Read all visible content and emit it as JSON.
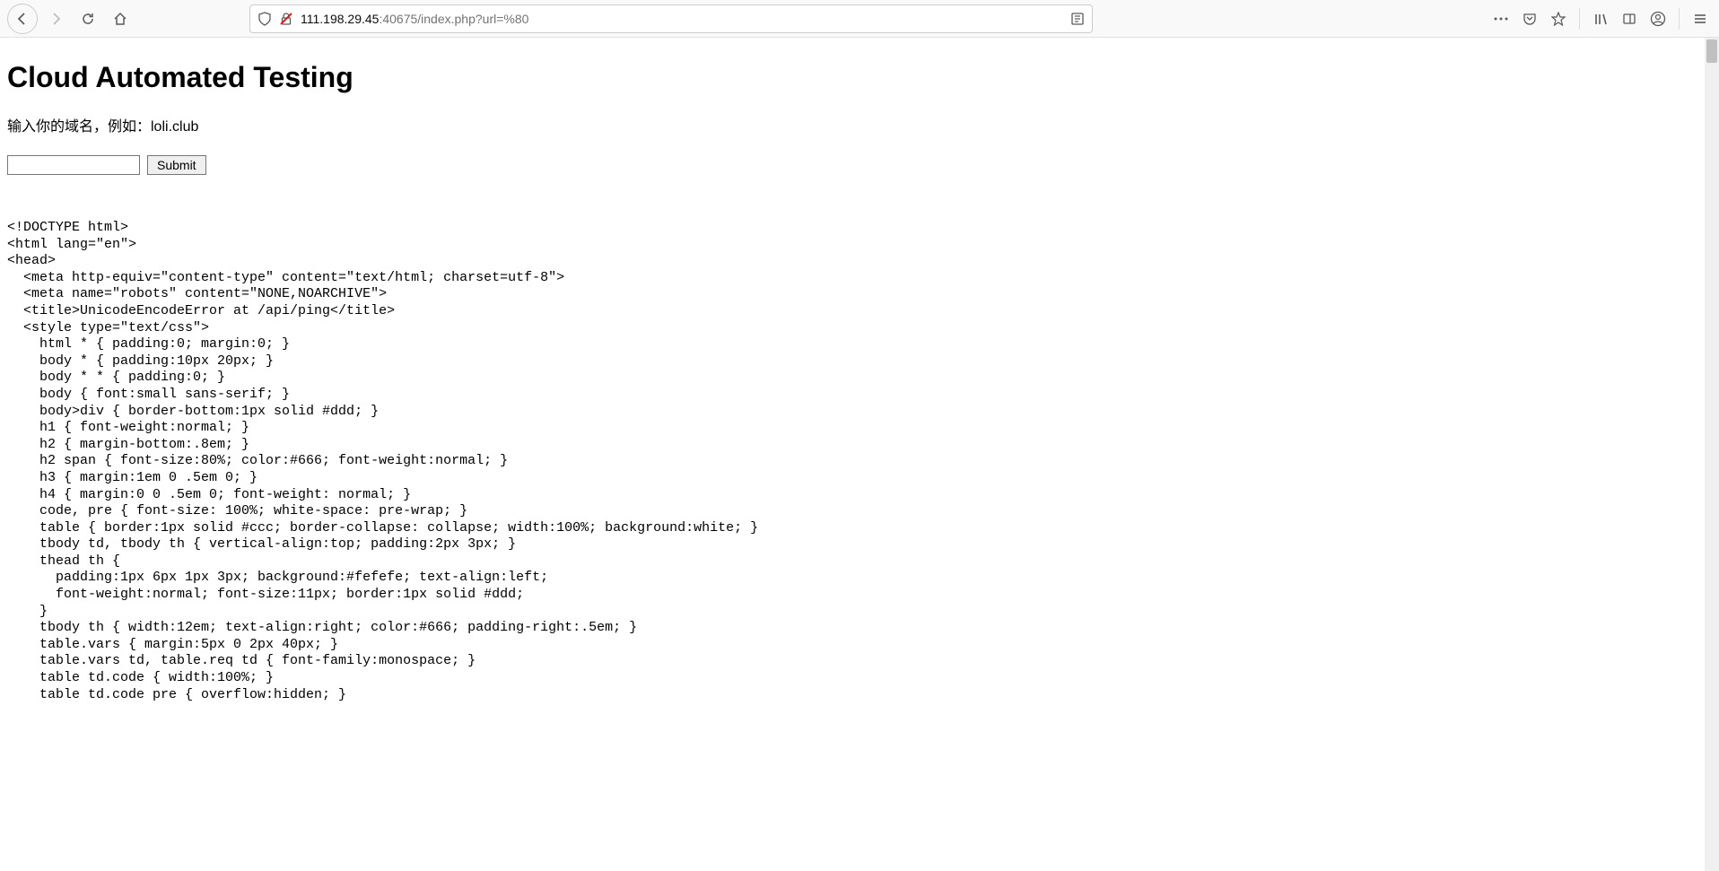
{
  "browser": {
    "url_display_prefix": "111.198.29.45",
    "url_display_suffix": ":40675/index.php?url=%80"
  },
  "page": {
    "title": "Cloud Automated Testing",
    "description": "输入你的域名，例如：loli.club",
    "submit_label": "Submit"
  },
  "code": [
    "<!DOCTYPE html>",
    "<html lang=\"en\">",
    "<head>",
    "  <meta http-equiv=\"content-type\" content=\"text/html; charset=utf-8\">",
    "  <meta name=\"robots\" content=\"NONE,NOARCHIVE\">",
    "  <title>UnicodeEncodeError at /api/ping</title>",
    "  <style type=\"text/css\">",
    "    html * { padding:0; margin:0; }",
    "    body * { padding:10px 20px; }",
    "    body * * { padding:0; }",
    "    body { font:small sans-serif; }",
    "    body>div { border-bottom:1px solid #ddd; }",
    "    h1 { font-weight:normal; }",
    "    h2 { margin-bottom:.8em; }",
    "    h2 span { font-size:80%; color:#666; font-weight:normal; }",
    "    h3 { margin:1em 0 .5em 0; }",
    "    h4 { margin:0 0 .5em 0; font-weight: normal; }",
    "    code, pre { font-size: 100%; white-space: pre-wrap; }",
    "    table { border:1px solid #ccc; border-collapse: collapse; width:100%; background:white; }",
    "    tbody td, tbody th { vertical-align:top; padding:2px 3px; }",
    "    thead th {",
    "      padding:1px 6px 1px 3px; background:#fefefe; text-align:left;",
    "      font-weight:normal; font-size:11px; border:1px solid #ddd;",
    "    }",
    "    tbody th { width:12em; text-align:right; color:#666; padding-right:.5em; }",
    "    table.vars { margin:5px 0 2px 40px; }",
    "    table.vars td, table.req td { font-family:monospace; }",
    "    table td.code { width:100%; }",
    "    table td.code pre { overflow:hidden; }"
  ]
}
